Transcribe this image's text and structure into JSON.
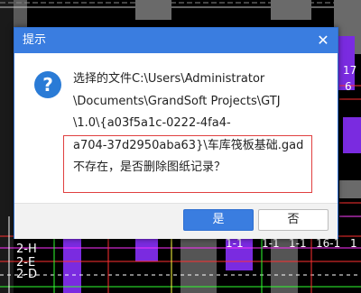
{
  "dialog": {
    "title": "提示",
    "close_glyph": "✕",
    "icon": "question-icon",
    "icon_glyph": "?",
    "message_lines": [
      "选择的文件C:\\Users\\Administrator",
      "\\Documents\\GrandSoft Projects\\GTJ",
      "\\1.0\\{a03f5a1c-0222-4fa4-",
      "a704-37d2950aba63}\\车库筏板基础.gad",
      "不存在，是否删除图纸记录？"
    ],
    "ok_label": "是",
    "cancel_label": "否"
  },
  "background": {
    "labels": [
      "17",
      "6",
      "2-H",
      "2-E",
      "2-D",
      "1-1",
      "1-1",
      "1-1",
      "16-1",
      "1"
    ]
  },
  "colors": {
    "titlebar": "#3a7de0",
    "accent": "#2f6fd0",
    "highlight_border": "#e04040",
    "cad_background": "#000000"
  }
}
